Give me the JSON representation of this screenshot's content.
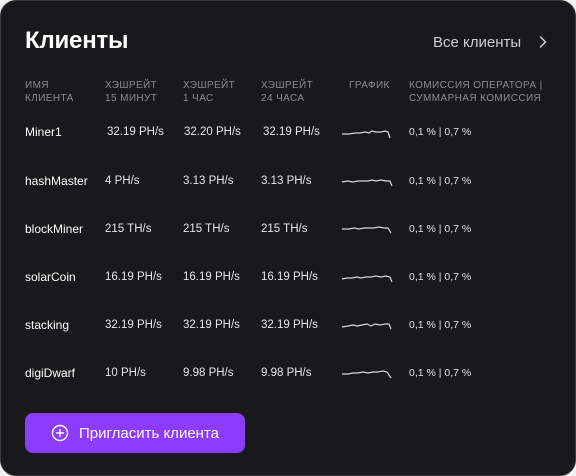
{
  "header": {
    "title": "Клиенты",
    "all_clients_label": "Все клиенты",
    "chevron_icon": "chevron-right-icon"
  },
  "table": {
    "columns": [
      "ИМЯ\nКЛИЕНТА",
      "ХЭШРЕЙТ\n15 МИНУТ",
      "ХЭШРЕЙТ\n1 ЧАС",
      "ХЭШРЕЙТ\n24 ЧАСА",
      "ГРАФИК",
      "КОМИССИЯ ОПЕРАТОРА |\nСУММАРНАЯ КОМИССИЯ"
    ],
    "rows": [
      {
        "name": "Miner1",
        "h15": "32.19 PH/s",
        "h1": "32.20 PH/s",
        "h24": "32.19 PH/s",
        "fee": "0,1 % | 0,7 %"
      },
      {
        "name": "hashMaster",
        "h15": "4 PH/s",
        "h1": "3.13 PH/s",
        "h24": "3.13 PH/s",
        "fee": "0,1 % | 0,7 %"
      },
      {
        "name": "blockMiner",
        "h15": "215 TH/s",
        "h1": "215 TH/s",
        "h24": "215 TH/s",
        "fee": "0,1 % | 0,7 %"
      },
      {
        "name": "solarCoin",
        "h15": "16.19 PH/s",
        "h1": "16.19 PH/s",
        "h24": "16.19 PH/s",
        "fee": "0,1 % | 0,7 %"
      },
      {
        "name": "stacking",
        "h15": "32.19 PH/s",
        "h1": "32.19 PH/s",
        "h24": "32.19 PH/s",
        "fee": "0,1 % | 0,7 %"
      },
      {
        "name": "digiDwarf",
        "h15": "10 PH/s",
        "h1": "9.98 PH/s",
        "h24": "9.98 PH/s",
        "fee": "0,1 % | 0,7 %"
      }
    ]
  },
  "invite_button": {
    "label": "Пригласить клиента",
    "icon": "plus-circle-icon"
  },
  "colors": {
    "background": "#19191b",
    "accent": "#8b3cff",
    "muted_text": "#8a8a90"
  }
}
